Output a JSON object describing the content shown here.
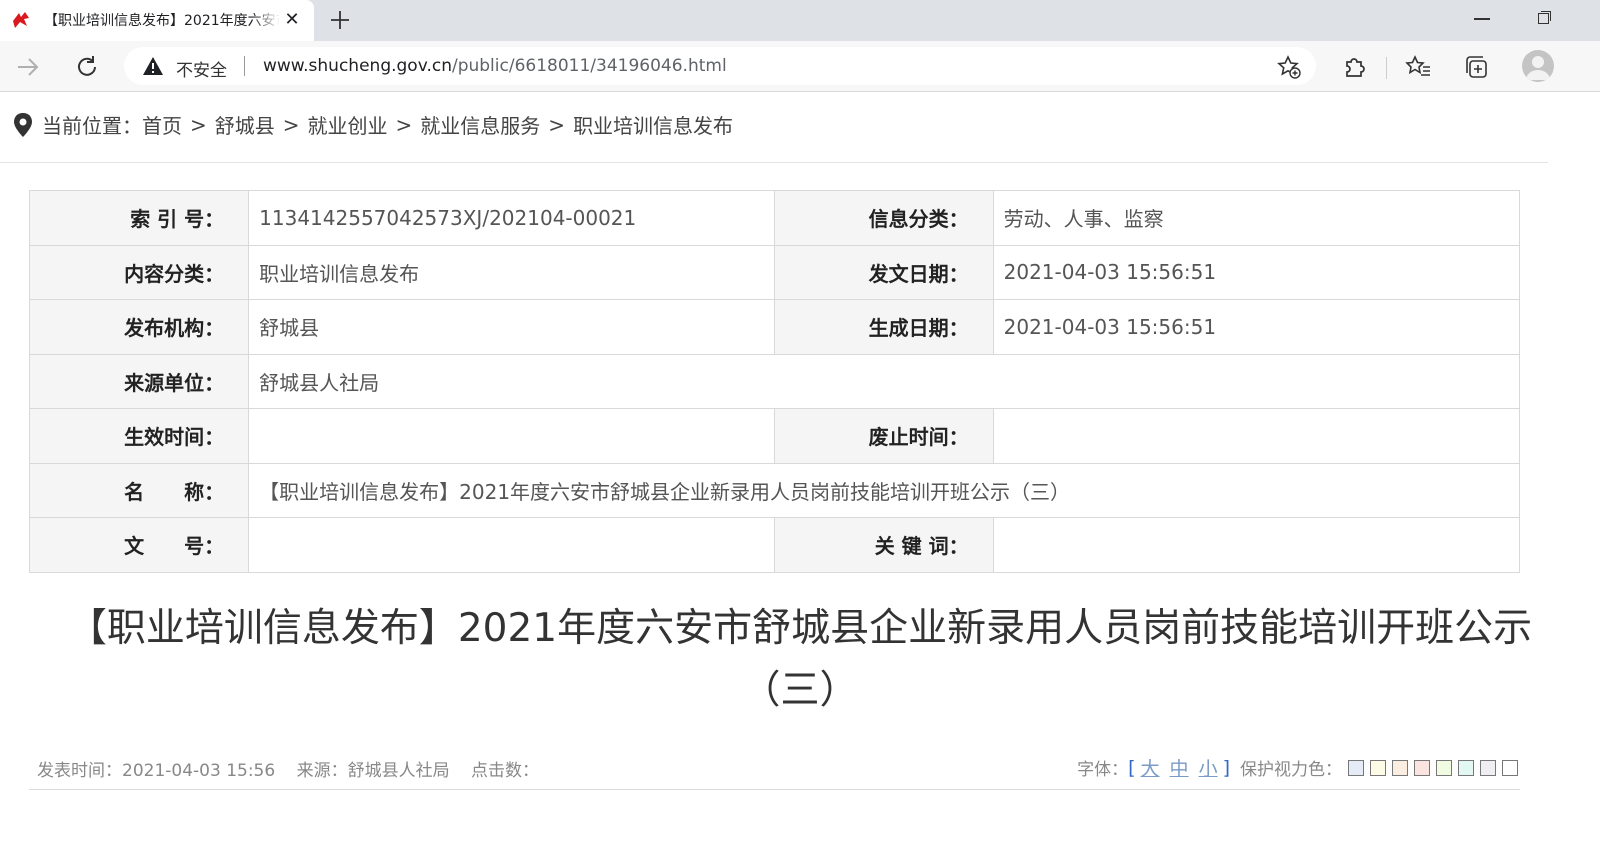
{
  "browser": {
    "tab_title": "【职业培训信息发布】2021年度六安市舒城县企业新录用人员岗前技能培训开班公示（三）",
    "security_label": "不安全",
    "url_host": "www.shucheng.gov.cn",
    "url_path": "/public/6618011/34196046.html"
  },
  "breadcrumb": {
    "prefix": "当前位置：",
    "items": [
      "首页",
      "舒城县",
      "就业创业",
      "就业信息服务",
      "职业培训信息发布"
    ],
    "separator": ">"
  },
  "meta": {
    "index_label": "索 引 号：",
    "index_value": "1134142557042573XJ/202104-00021",
    "info_class_label": "信息分类：",
    "info_class_value": "劳动、人事、监察",
    "content_class_label": "内容分类：",
    "content_class_value": "职业培训信息发布",
    "issue_date_label": "发文日期：",
    "issue_date_value": "2021-04-03 15:56:51",
    "publisher_label": "发布机构：",
    "publisher_value": "舒城县",
    "gen_date_label": "生成日期：",
    "gen_date_value": "2021-04-03 15:56:51",
    "source_label": "来源单位：",
    "source_value": "舒城县人社局",
    "effective_label": "生效时间：",
    "effective_value": "",
    "abolish_label": "废止时间：",
    "abolish_value": "",
    "name_label": "名　　称：",
    "name_value": "【职业培训信息发布】2021年度六安市舒城县企业新录用人员岗前技能培训开班公示（三）",
    "doc_no_label": "文　　号：",
    "doc_no_value": "",
    "keywords_label": "关 键 词：",
    "keywords_value": ""
  },
  "article": {
    "title": "【职业培训信息发布】2021年度六安市舒城县企业新录用人员岗前技能培训开班公示（三）",
    "publish_time": "发表时间：2021-04-03 15:56",
    "source": "来源：舒城县人社局",
    "clicks": "点击数：",
    "font_label": "字体：",
    "font_open": "[",
    "font_large": "大",
    "font_medium": "中",
    "font_small": "小",
    "font_close": "]",
    "eye_label": "保护视力色：",
    "eye_colors": [
      "#e6ecf7",
      "#fdfbe5",
      "#fbeee0",
      "#fbe3e0",
      "#f0fbe2",
      "#e3f8f3",
      "#eeeef3",
      "#ffffff"
    ]
  }
}
